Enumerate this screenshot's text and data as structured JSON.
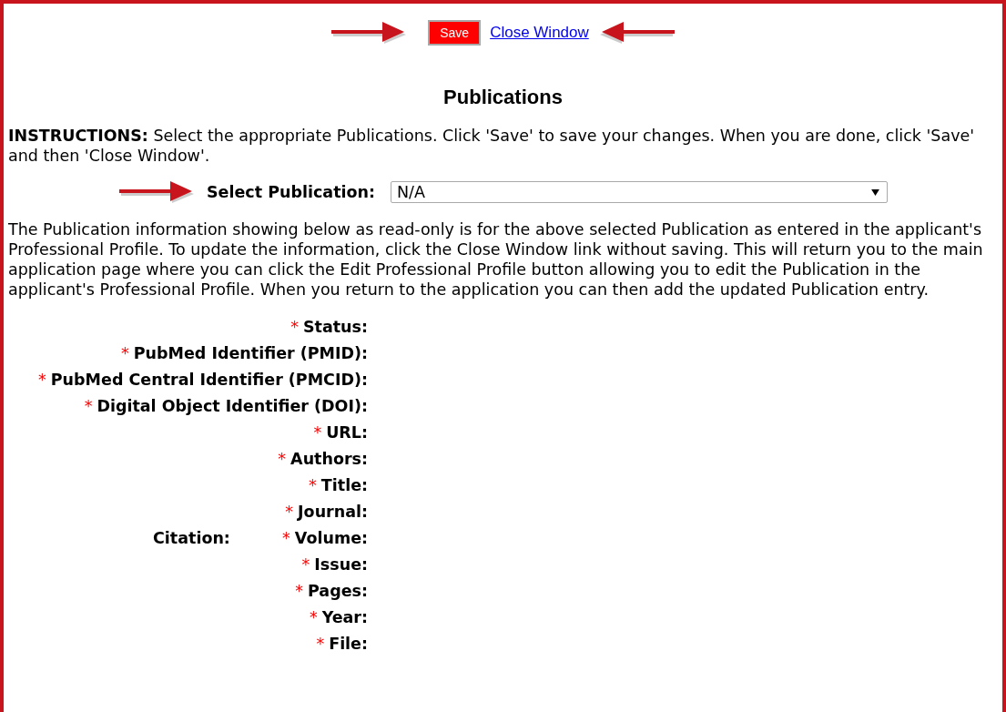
{
  "toolbar": {
    "save_button": "Save",
    "close_link": "Close Window"
  },
  "heading": "Publications",
  "instructions": "**INSTRUCTIONS:** Select the appropriate Publications. Click 'Save' to save your changes. When you are done, click 'Save' and then 'Close Window'.",
  "select": {
    "label": "Select Publication:",
    "value": "N/A"
  },
  "description": "The Publication information showing below as read-only is for the above selected Publication as entered in the applicant's Professional Profile. To update the information, click the Close Window link without saving. This will return you to the main application page where you can click the Edit Professional Profile button allowing you to edit the Publication in the applicant's Professional Profile. When you return to the application you can then add the updated Publication entry.",
  "fields": [
    {
      "label": "Status:",
      "required_mark": "*"
    },
    {
      "label": "PubMed Identifier (PMID):",
      "required_mark": "*"
    },
    {
      "label": "PubMed Central Identifier (PMCID):",
      "required_mark": "*"
    },
    {
      "label": "Digital Object Identifier (DOI):",
      "required_mark": "*"
    },
    {
      "label": "URL:",
      "required_mark": "*"
    }
  ],
  "citation": {
    "label": "Citation:",
    "fields": [
      {
        "label": "Authors:",
        "required_mark": "*"
      },
      {
        "label": "Title:",
        "required_mark": "*"
      },
      {
        "label": "Journal:",
        "required_mark": "*"
      },
      {
        "label": "Volume:",
        "required_mark": "*"
      },
      {
        "label": "Issue:",
        "required_mark": "*"
      },
      {
        "label": "Pages:",
        "required_mark": "*"
      },
      {
        "label": "Year:",
        "required_mark": "*"
      },
      {
        "label": "File:",
        "required_mark": "*"
      }
    ]
  }
}
